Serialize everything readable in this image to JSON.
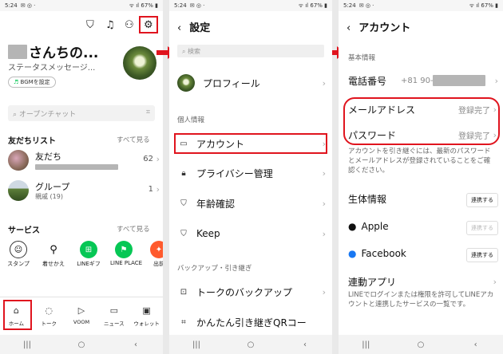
{
  "status_bar": {
    "time": "5:24",
    "battery": "67%"
  },
  "panel1": {
    "name_suffix": "さんちの...",
    "status_message": "ステータスメッセージ...",
    "bgm_label": "BGMを設定",
    "search_placeholder": "オープンチャット",
    "friends_title": "友だちリスト",
    "see_all": "すべて見る",
    "friends": [
      {
        "label": "友だち",
        "count": "62"
      },
      {
        "label": "グループ",
        "sub": "親戚 (19)",
        "count": "1"
      }
    ],
    "services_title": "サービス",
    "services_see_all": "すべて見る",
    "services": [
      {
        "label": "スタンプ",
        "icon": "smile-icon",
        "color": "#ffffff"
      },
      {
        "label": "着せかえ",
        "icon": "brush-icon",
        "color": "#ffffff"
      },
      {
        "label": "LINEギフ",
        "icon": "gift-icon",
        "color": "#06c755"
      },
      {
        "label": "LINE PLACE",
        "icon": "flag-icon",
        "color": "#06c755"
      },
      {
        "label": "出前",
        "icon": "food-icon",
        "color": "#ff5a2d"
      }
    ],
    "tabs": [
      "ホーム",
      "トーク",
      "VOOM",
      "ニュース",
      "ウォレット"
    ]
  },
  "panel2": {
    "title": "設定",
    "search_placeholder": "検索",
    "profile_label": "プロフィール",
    "group1_label": "個人情報",
    "items": [
      "アカウント",
      "プライバシー管理",
      "年齢確認",
      "Keep"
    ],
    "group2_label": "バックアップ・引き継ぎ",
    "items2": [
      "トークのバックアップ",
      "かんたん引き継ぎQRコー"
    ]
  },
  "panel3": {
    "title": "アカウント",
    "basic_label": "基本情報",
    "phone_label": "電話番号",
    "phone_value": "+81 90-",
    "email_label": "メールアドレス",
    "email_value": "登録完了",
    "password_label": "パスワード",
    "password_value": "登録完了",
    "note1": "アカウントを引き継ぐには、最新のパスワードとメールアドレスが登録されていることをご確認ください。",
    "bio_label": "生体情報",
    "apple_label": "Apple",
    "facebook_label": "Facebook",
    "connect_label": "連携する",
    "linked_apps_label": "連動アプリ",
    "note2": "LINEでログインまたは権限を許可してLINEアカウントと連携したサービスの一覧です。"
  },
  "colors": {
    "highlight": "#e0141e",
    "line_green": "#06c755"
  }
}
